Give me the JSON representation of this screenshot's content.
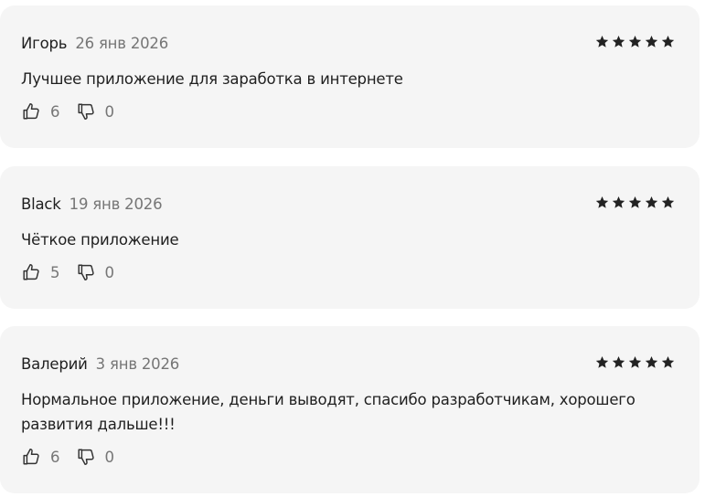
{
  "reviews": [
    {
      "author": "Игорь",
      "date": "26 янв 2026",
      "rating": 5,
      "text": "Лучшее приложение для заработка в интернете",
      "likes": "6",
      "dislikes": "0"
    },
    {
      "author": "Black",
      "date": "19 янв 2026",
      "rating": 5,
      "text": "Чёткое приложение",
      "likes": "5",
      "dislikes": "0"
    },
    {
      "author": "Валерий",
      "date": "3 янв 2026",
      "rating": 5,
      "text": "Нормальное приложение, деньги выводят, спасибо разработчикам, хорошего развития дальше!!!",
      "likes": "6",
      "dislikes": "0"
    }
  ],
  "icons": {
    "star": "star-icon",
    "like": "thumbs-up-icon",
    "dislike": "thumbs-down-icon"
  },
  "colors": {
    "card_background": "#f5f5f5",
    "star": "#222222",
    "muted_text": "#767676"
  }
}
